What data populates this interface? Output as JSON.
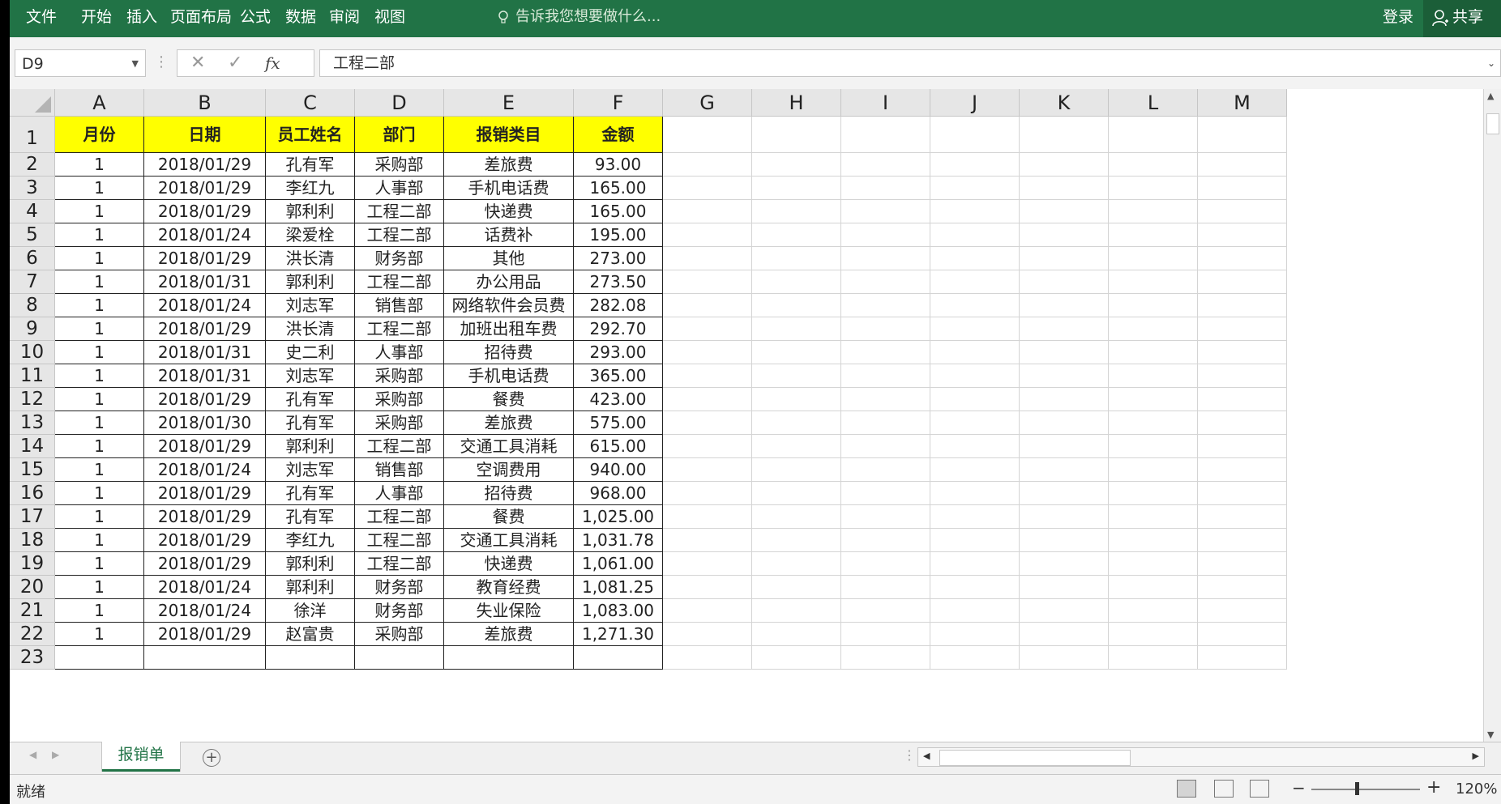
{
  "ribbon": {
    "tabs": [
      "文件",
      "开始",
      "插入",
      "页面布局",
      "公式",
      "数据",
      "审阅",
      "视图"
    ],
    "tell_me": "告诉我您想要做什么...",
    "login": "登录",
    "share": "共享"
  },
  "formula_bar": {
    "name_box": "D9",
    "formula": "工程二部"
  },
  "columns": [
    "A",
    "B",
    "C",
    "D",
    "E",
    "F",
    "G",
    "H",
    "I",
    "J",
    "K",
    "L",
    "M"
  ],
  "table": {
    "headers": [
      "月份",
      "日期",
      "员工姓名",
      "部门",
      "报销类目",
      "金额"
    ],
    "rows": [
      [
        "1",
        "2018/01/29",
        "孔有军",
        "采购部",
        "差旅费",
        "93.00"
      ],
      [
        "1",
        "2018/01/29",
        "李红九",
        "人事部",
        "手机电话费",
        "165.00"
      ],
      [
        "1",
        "2018/01/29",
        "郭利利",
        "工程二部",
        "快递费",
        "165.00"
      ],
      [
        "1",
        "2018/01/24",
        "梁爱栓",
        "工程二部",
        "话费补",
        "195.00"
      ],
      [
        "1",
        "2018/01/29",
        "洪长清",
        "财务部",
        "其他",
        "273.00"
      ],
      [
        "1",
        "2018/01/31",
        "郭利利",
        "工程二部",
        "办公用品",
        "273.50"
      ],
      [
        "1",
        "2018/01/24",
        "刘志军",
        "销售部",
        "网络软件会员费",
        "282.08"
      ],
      [
        "1",
        "2018/01/29",
        "洪长清",
        "工程二部",
        "加班出租车费",
        "292.70"
      ],
      [
        "1",
        "2018/01/31",
        "史二利",
        "人事部",
        "招待费",
        "293.00"
      ],
      [
        "1",
        "2018/01/31",
        "刘志军",
        "采购部",
        "手机电话费",
        "365.00"
      ],
      [
        "1",
        "2018/01/29",
        "孔有军",
        "采购部",
        "餐费",
        "423.00"
      ],
      [
        "1",
        "2018/01/30",
        "孔有军",
        "采购部",
        "差旅费",
        "575.00"
      ],
      [
        "1",
        "2018/01/29",
        "郭利利",
        "工程二部",
        "交通工具消耗",
        "615.00"
      ],
      [
        "1",
        "2018/01/24",
        "刘志军",
        "销售部",
        "空调费用",
        "940.00"
      ],
      [
        "1",
        "2018/01/29",
        "孔有军",
        "人事部",
        "招待费",
        "968.00"
      ],
      [
        "1",
        "2018/01/29",
        "孔有军",
        "工程二部",
        "餐费",
        "1,025.00"
      ],
      [
        "1",
        "2018/01/29",
        "李红九",
        "工程二部",
        "交通工具消耗",
        "1,031.78"
      ],
      [
        "1",
        "2018/01/29",
        "郭利利",
        "工程二部",
        "快递费",
        "1,061.00"
      ],
      [
        "1",
        "2018/01/24",
        "郭利利",
        "财务部",
        "教育经费",
        "1,081.25"
      ],
      [
        "1",
        "2018/01/24",
        "徐洋",
        "财务部",
        "失业保险",
        "1,083.00"
      ],
      [
        "1",
        "2018/01/29",
        "赵富贵",
        "采购部",
        "差旅费",
        "1,271.30"
      ]
    ]
  },
  "sheet_tabs": [
    "报销单"
  ],
  "status": {
    "ready": "就绪",
    "zoom": "120%",
    "zoom_minus": "−",
    "zoom_plus": "+"
  },
  "colors": {
    "ribbon": "#217346",
    "header_fill": "#ffff00"
  }
}
